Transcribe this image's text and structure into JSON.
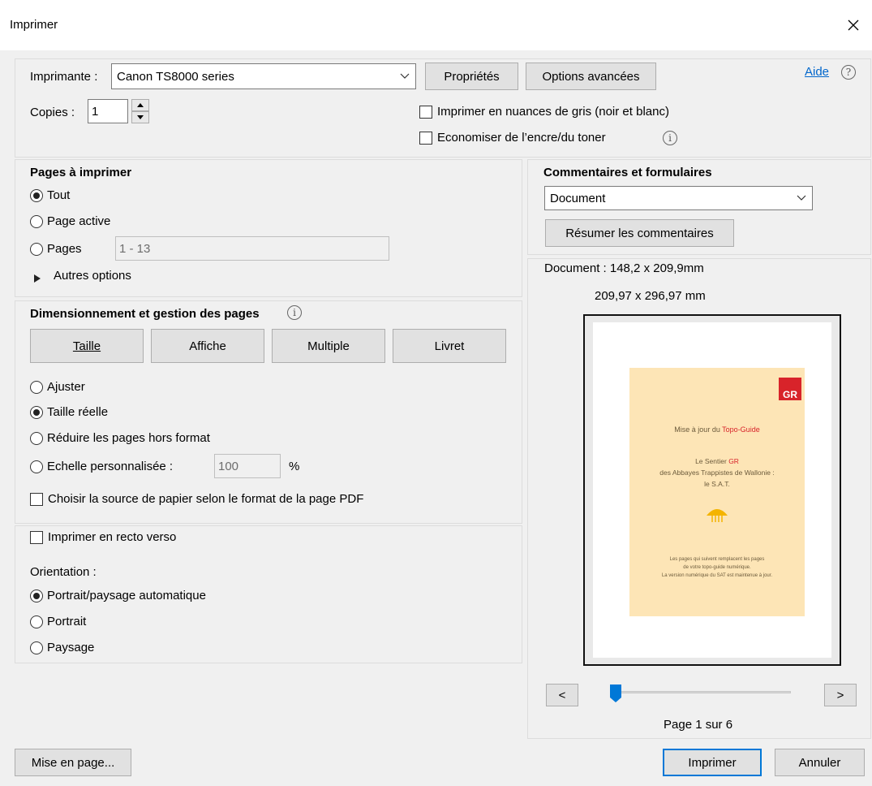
{
  "window": {
    "title": "Imprimer"
  },
  "printer": {
    "label": "Imprimante :",
    "selected": "Canon TS8000 series",
    "properties_button": "Propriétés",
    "advanced_button": "Options avancées",
    "help_link": "Aide",
    "copies_label": "Copies :",
    "copies_value": "1",
    "grayscale_label": "Imprimer en nuances de gris (noir et blanc)",
    "save_ink_label": "Economiser de l’encre/du toner"
  },
  "pages": {
    "heading": "Pages à imprimer",
    "all": "Tout",
    "current": "Page active",
    "range_label": "Pages",
    "range_value": "1 - 13",
    "more_options": "Autres options"
  },
  "sizing": {
    "heading": "Dimensionnement et gestion des pages",
    "buttons": [
      "Taille",
      "Affiche",
      "Multiple",
      "Livret"
    ],
    "fit": "Ajuster",
    "actual_size": "Taille réelle",
    "shrink": "Réduire les pages hors format",
    "custom_scale": "Echelle personnalisée :",
    "scale_value": "100",
    "percent": "%",
    "paper_source": "Choisir la source de papier selon le format de la page PDF"
  },
  "duplex": {
    "label": "Imprimer en recto verso",
    "orientation_label": "Orientation :",
    "auto": "Portrait/paysage automatique",
    "portrait": "Portrait",
    "landscape": "Paysage"
  },
  "comments": {
    "heading": "Commentaires et formulaires",
    "selected": "Document",
    "summarize_button": "Résumer les commentaires"
  },
  "preview": {
    "doc_size": "Document : 148,2 x 209,9mm",
    "paper_size": "209,97 x 296,97 mm",
    "page_text": {
      "logo": "GR",
      "line1a": "Mise à jour du ",
      "line1b": "Topo-Guide",
      "line2a": "Le Sentier ",
      "line2b": "GR",
      "line3": "des Abbayes Trappistes de Wallonie :",
      "line4": "le S.A.T.",
      "footer1": "Les pages qui suivent remplacent les pages",
      "footer2": "de votre topo-guide numérique.",
      "footer3": "La version numérique du SAT est maintenue à jour."
    },
    "prev_button": "<",
    "next_button": ">",
    "page_indicator": "Page 1 sur 6",
    "slider_position": 0
  },
  "footer": {
    "page_setup_button": "Mise en page...",
    "print_button": "Imprimer",
    "cancel_button": "Annuler"
  },
  "colors": {
    "accent": "#0078d7",
    "preview_bg": "#fde5b6",
    "gr_red": "#d8232a"
  }
}
